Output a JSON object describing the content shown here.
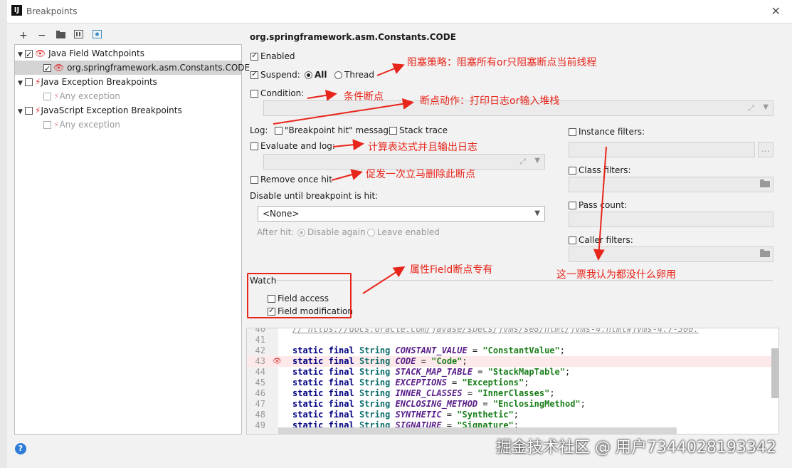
{
  "window": {
    "title": "Breakpoints",
    "app_icon": "IJ"
  },
  "toolbar": {
    "add": "+",
    "remove": "−"
  },
  "tree": {
    "items": [
      {
        "label": "Java Field Watchpoints"
      },
      {
        "label": "org.springframework.asm.Constants.CODE"
      },
      {
        "label": "Java Exception Breakpoints"
      },
      {
        "label": "Any exception"
      },
      {
        "label": "JavaScript Exception Breakpoints"
      },
      {
        "label": "Any exception"
      }
    ]
  },
  "details": {
    "title": "org.springframework.asm.Constants.CODE",
    "enabled": "Enabled",
    "suspend": "Suspend:",
    "all": "All",
    "thread": "Thread",
    "condition": "Condition:",
    "log": "Log:",
    "bp_hit_message": "\"Breakpoint hit\" message",
    "stack_trace": "Stack trace",
    "evaluate_and_log": "Evaluate and log:",
    "remove_once_hit": "Remove once hit",
    "disable_until": "Disable until breakpoint is hit:",
    "none_option": "<None>",
    "after_hit": "After hit:",
    "disable_again": "Disable again",
    "leave_enabled": "Leave enabled",
    "instance_filters": "Instance filters:",
    "class_filters": "Class filters:",
    "pass_count": "Pass count:",
    "caller_filters": "Caller filters:",
    "watch": "Watch",
    "field_access": "Field access",
    "field_modification": "Field modification"
  },
  "annotations": {
    "suspend_policy": "阻塞策略：阻塞所有or只阻塞断点当前线程",
    "condition": "条件断点",
    "action": "断点动作：打印日志or输入堆栈",
    "evaluate": "计算表达式并且输出日志",
    "remove": "促发一次立马删除此断点",
    "field_only": "属性Field断点专有",
    "filters": "这一票我认为都没什么卵用"
  },
  "code": {
    "top_comment_number": "40",
    "top_comment": "// https://docs.oracle.com/javase/specs/jvms/se8/html/jvms-4.html#jvms-4.7-300.",
    "lines": [
      {
        "n": "41",
        "name": "",
        "value": ""
      },
      {
        "n": "42",
        "name": "CONSTANT_VALUE",
        "value": "\"ConstantValue\""
      },
      {
        "n": "43",
        "name": "CODE",
        "value": "\"Code\""
      },
      {
        "n": "44",
        "name": "STACK_MAP_TABLE",
        "value": "\"StackMapTable\""
      },
      {
        "n": "45",
        "name": "EXCEPTIONS",
        "value": "\"Exceptions\""
      },
      {
        "n": "46",
        "name": "INNER_CLASSES",
        "value": "\"InnerClasses\""
      },
      {
        "n": "47",
        "name": "ENCLOSING_METHOD",
        "value": "\"EnclosingMethod\""
      },
      {
        "n": "48",
        "name": "SYNTHETIC",
        "value": "\"Synthetic\""
      },
      {
        "n": "49",
        "name": "SIGNATURE",
        "value": "\"Signature\""
      }
    ],
    "kw1": "static",
    "kw2": "final",
    "type": "String",
    "eq": " = ",
    "semi": ";"
  },
  "watermark": "掘金技术社区 @ 用户7344028193342",
  "help": "?"
}
